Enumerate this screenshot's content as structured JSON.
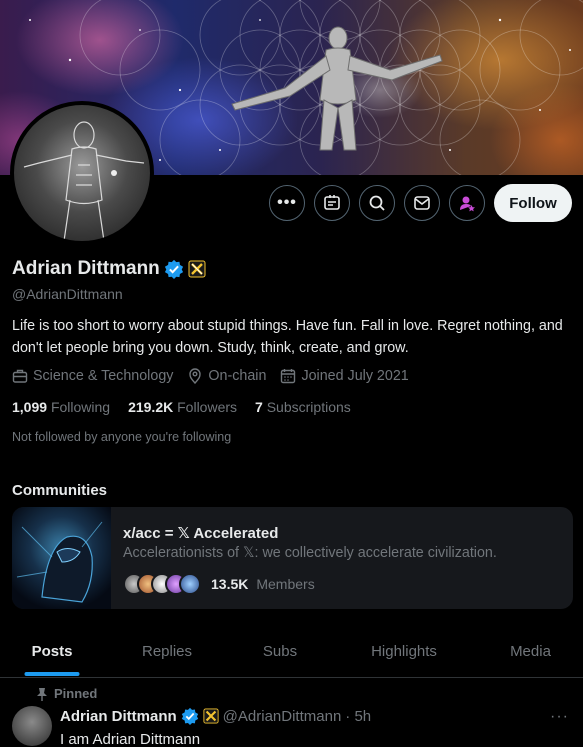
{
  "profile": {
    "name": "Adrian Dittmann",
    "handle": "@AdrianDittmann",
    "bio": "Life is too short to worry about stupid things. Have fun. Fall in love. Regret nothing, and don't let people bring you down. Study, think, create, and grow.",
    "category": "Science & Technology",
    "location": "On-chain",
    "joined": "Joined July 2021",
    "following_count": "1,099",
    "following_label": "Following",
    "followers_count": "219.2K",
    "followers_label": "Followers",
    "subscriptions_count": "7",
    "subscriptions_label": "Subscriptions",
    "not_followed_text": "Not followed by anyone you're following"
  },
  "actions": {
    "follow_label": "Follow",
    "more_icon": "more-icon",
    "grok_icon": "grok-icon",
    "search_icon": "search-icon",
    "message_icon": "message-icon",
    "subscribe_icon": "subscribe-icon"
  },
  "communities": {
    "title": "Communities",
    "items": [
      {
        "name": "x/acc = 𝕏 Accelerated",
        "description": "Accelerationists of 𝕏: we collectively accelerate civilization.",
        "members_count": "13.5K",
        "members_label": "Members"
      }
    ]
  },
  "tabs": [
    {
      "label": "Posts",
      "active": true
    },
    {
      "label": "Replies",
      "active": false
    },
    {
      "label": "Subs",
      "active": false
    },
    {
      "label": "Highlights",
      "active": false
    },
    {
      "label": "Media",
      "active": false
    }
  ],
  "pinned_post": {
    "pinned_label": "Pinned",
    "author_name": "Adrian Dittmann",
    "author_handle": "@AdrianDittmann",
    "time": "· 5h",
    "text": "I am Adrian Dittmann",
    "more_label": "···"
  },
  "colors": {
    "accent": "#1d9bf0",
    "verified": "#1d9bf0",
    "affiliate_badge": "#f4c430",
    "subscribe_icon": "#c94cd8",
    "background": "#000000",
    "muted_text": "#71767b"
  }
}
